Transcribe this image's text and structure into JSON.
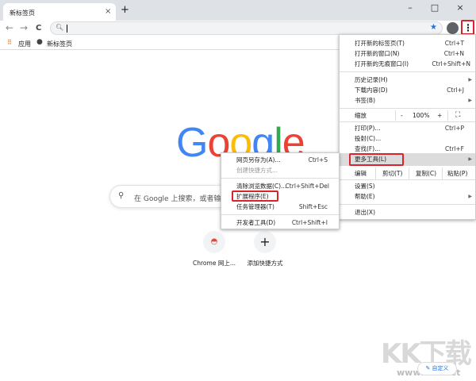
{
  "tab": {
    "title": "新标签页",
    "close": "×",
    "new_tab": "+"
  },
  "window": {
    "minimize": "–",
    "maximize": "□",
    "close": "×"
  },
  "toolbar": {
    "back": "←",
    "forward": "→",
    "reload": "C",
    "star": "★",
    "menu": "⋮"
  },
  "bookmarks": [
    {
      "label": "应用"
    },
    {
      "label": "新标签页"
    }
  ],
  "menu": {
    "items": [
      {
        "label": "打开新的标签页(T)",
        "shortcut": "Ctrl+T"
      },
      {
        "label": "打开新的窗口(N)",
        "shortcut": "Ctrl+N"
      },
      {
        "label": "打开新的无痕窗口(I)",
        "shortcut": "Ctrl+Shift+N"
      },
      {
        "label": "历史记录(H)"
      },
      {
        "label": "下载内容(D)",
        "shortcut": "Ctrl+J"
      },
      {
        "label": "书签(B)"
      },
      {
        "label": "打印(P)...",
        "shortcut": "Ctrl+P"
      },
      {
        "label": "投射(C)..."
      },
      {
        "label": "查找(F)...",
        "shortcut": "Ctrl+F"
      },
      {
        "label": "更多工具(L)"
      },
      {
        "label": "设置(S)"
      },
      {
        "label": "帮助(E)"
      },
      {
        "label": "退出(X)"
      }
    ],
    "zoom": {
      "label": "缩放",
      "minus": "-",
      "value": "100%",
      "plus": "+",
      "fullscreen": "⛶"
    },
    "edit": {
      "label": "编辑",
      "cut": "剪切(T)",
      "copy": "复制(C)",
      "paste": "粘贴(P)"
    }
  },
  "submenu": [
    {
      "label": "网页另存为(A)...",
      "shortcut": "Ctrl+S"
    },
    {
      "label": "创建快捷方式..."
    },
    {
      "label": "清除浏览数据(C)...",
      "shortcut": "Ctrl+Shift+Del"
    },
    {
      "label": "扩展程序(E)"
    },
    {
      "label": "任务管理器(T)",
      "shortcut": "Shift+Esc"
    },
    {
      "label": "开发者工具(D)",
      "shortcut": "Ctrl+Shift+I"
    }
  ],
  "search": {
    "placeholder": "在 Google 上搜索，或者输"
  },
  "logo": "Google",
  "shortcuts": [
    {
      "label": "Chrome 网上..."
    },
    {
      "label": "添加快捷方式",
      "icon": "+"
    }
  ],
  "customize": "✎ 自定义",
  "watermark": {
    "brand": "KK下载",
    "url": "www.kkx.net"
  }
}
